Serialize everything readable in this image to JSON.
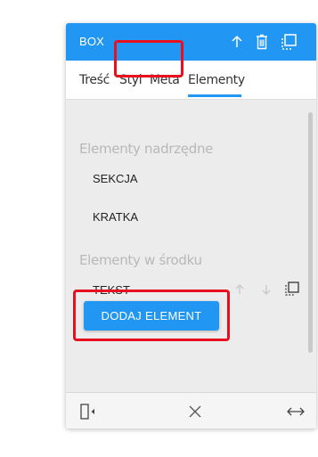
{
  "header": {
    "title": "BOX",
    "icons": [
      "arrow-up-icon",
      "trash-icon",
      "copy-icon"
    ]
  },
  "tabs": [
    {
      "label": "Treść",
      "active": false
    },
    {
      "label": "Styl",
      "active": false
    },
    {
      "label": "Meta",
      "active": false
    },
    {
      "label": "Elementy",
      "active": true
    }
  ],
  "parents": {
    "label": "Elementy nadrzędne",
    "items": [
      "SEKCJA",
      "KRATKA"
    ]
  },
  "children": {
    "label": "Elementy w środku",
    "items": [
      {
        "label": "TEKST",
        "icons": [
          "move-up-icon",
          "move-down-icon",
          "copy-icon"
        ]
      }
    ]
  },
  "add_button": {
    "label": "DODAJ ELEMENT"
  },
  "footer": {
    "icons": [
      "dock-panel-icon",
      "close-icon",
      "resize-horizontal-icon"
    ]
  },
  "colors": {
    "accent": "#2196f3",
    "highlight": "#e8101e",
    "panel_bg": "#ececec",
    "muted_text": "#b8b8b8"
  }
}
